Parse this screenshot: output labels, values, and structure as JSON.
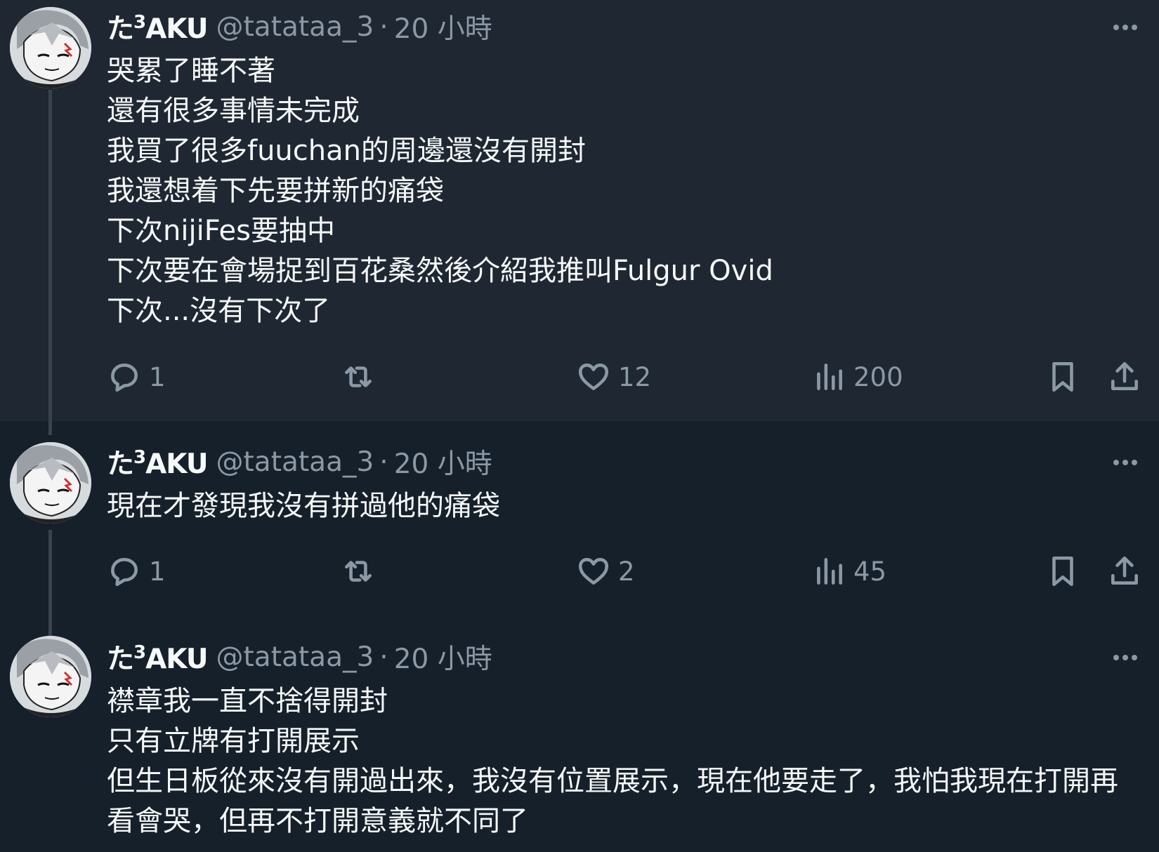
{
  "tweets": [
    {
      "author": {
        "name": "た",
        "name_sup": "3",
        "name_rest": "AKU",
        "handle": "@tatataa_3",
        "separator": "·",
        "time": "20 小時"
      },
      "lines": [
        "哭累了睡不著",
        "還有很多事情未完成",
        "我買了很多fuuchan的周邊還沒有開封",
        "我還想着下先要拼新的痛袋",
        "下次nijiFes要抽中",
        "下次要在會場捉到百花桑然後介紹我推叫Fulgur Ovid",
        "下次...沒有下次了"
      ],
      "stats": {
        "replies": "1",
        "retweets": "",
        "likes": "12",
        "views": "200"
      }
    },
    {
      "author": {
        "name": "た",
        "name_sup": "3",
        "name_rest": "AKU",
        "handle": "@tatataa_3",
        "separator": "·",
        "time": "20 小時"
      },
      "lines": [
        "現在才發現我沒有拼過他的痛袋"
      ],
      "stats": {
        "replies": "1",
        "retweets": "",
        "likes": "2",
        "views": "45"
      }
    },
    {
      "author": {
        "name": "た",
        "name_sup": "3",
        "name_rest": "AKU",
        "handle": "@tatataa_3",
        "separator": "·",
        "time": "20 小時"
      },
      "lines": [
        "襟章我一直不捨得開封",
        "只有立牌有打開展示",
        "但生日板從來沒有開過出來，我沒有位置展示，現在他要走了，我怕我現在打開再看會哭，但再不打開意義就不同了"
      ],
      "stats": {}
    }
  ],
  "icons": {
    "more": "more-horizontal-icon",
    "reply": "reply-icon",
    "retweet": "retweet-icon",
    "like": "heart-icon",
    "views": "views-icon",
    "bookmark": "bookmark-icon",
    "share": "share-icon",
    "avatar": "avatar"
  },
  "colors": {
    "background": "#15202b",
    "highlight_background": "#1e2732",
    "text_primary": "#f7f9f9",
    "text_secondary": "#8b98a5",
    "thread_line": "#38444d"
  }
}
